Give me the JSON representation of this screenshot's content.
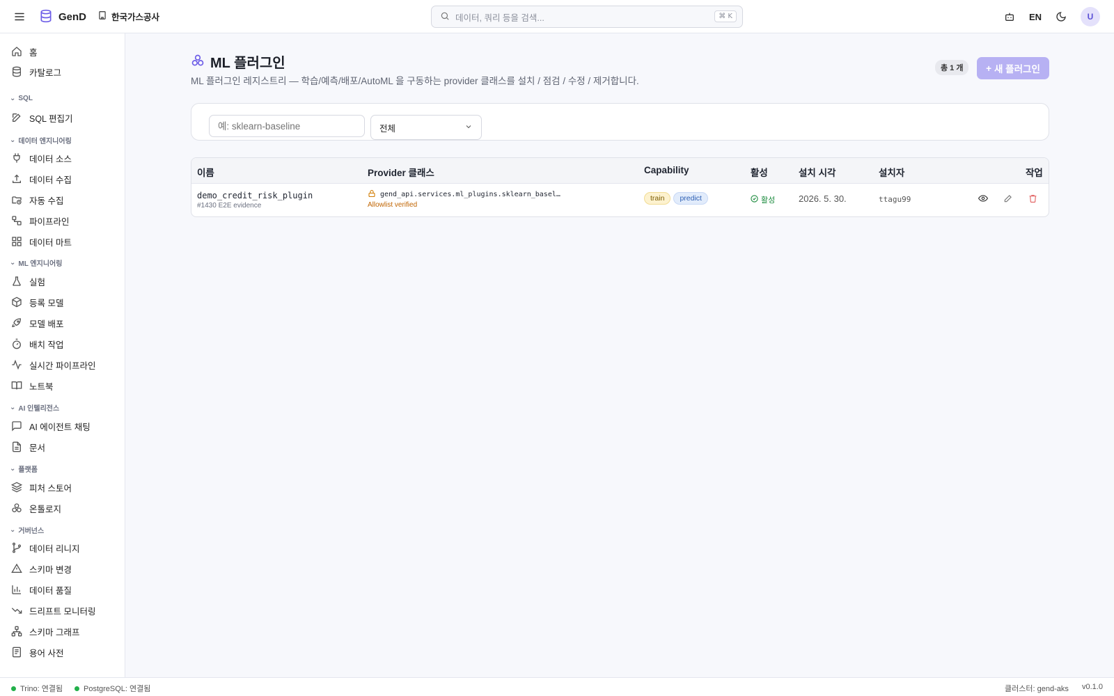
{
  "app": {
    "name": "GenD",
    "org": "한국가스공사"
  },
  "search": {
    "placeholder": "데이터, 쿼리 등을 검색...",
    "shortcut": "⌘ K"
  },
  "topbar": {
    "lang": "EN",
    "avatar": "U"
  },
  "sidebar": {
    "items": [
      {
        "label": "홈",
        "icon": "home-icon"
      },
      {
        "label": "카탈로그",
        "icon": "database-icon"
      }
    ],
    "sections": [
      {
        "title": "SQL",
        "items": [
          {
            "label": "SQL 편집기",
            "icon": "edit-icon"
          }
        ]
      },
      {
        "title": "데이터 엔지니어링",
        "items": [
          {
            "label": "데이터 소스",
            "icon": "plug-icon"
          },
          {
            "label": "데이터 수집",
            "icon": "upload-icon"
          },
          {
            "label": "자동 수집",
            "icon": "folder-clock-icon"
          },
          {
            "label": "파이프라인",
            "icon": "workflow-icon"
          },
          {
            "label": "데이터 마트",
            "icon": "grid-icon"
          }
        ]
      },
      {
        "title": "ML 엔지니어링",
        "items": [
          {
            "label": "실험",
            "icon": "flask-icon"
          },
          {
            "label": "등록 모델",
            "icon": "box-icon"
          },
          {
            "label": "모델 배포",
            "icon": "rocket-icon"
          },
          {
            "label": "배치 작업",
            "icon": "timer-icon"
          },
          {
            "label": "실시간 파이프라인",
            "icon": "activity-icon"
          },
          {
            "label": "노트북",
            "icon": "book-icon"
          }
        ]
      },
      {
        "title": "AI 인텔리전스",
        "items": [
          {
            "label": "AI 에이전트 채팅",
            "icon": "chat-icon"
          },
          {
            "label": "문서",
            "icon": "file-icon"
          }
        ]
      },
      {
        "title": "플랫폼",
        "items": [
          {
            "label": "피처 스토어",
            "icon": "layers-icon"
          },
          {
            "label": "온톨로지",
            "icon": "ontology-icon"
          }
        ]
      },
      {
        "title": "거버넌스",
        "items": [
          {
            "label": "데이터 리니지",
            "icon": "git-branch-icon"
          },
          {
            "label": "스키마 변경",
            "icon": "warning-icon"
          },
          {
            "label": "데이터 품질",
            "icon": "bar-chart-icon"
          },
          {
            "label": "드리프트 모니터링",
            "icon": "trending-down-icon"
          },
          {
            "label": "스키마 그래프",
            "icon": "network-icon"
          },
          {
            "label": "용어 사전",
            "icon": "dictionary-icon"
          }
        ]
      }
    ]
  },
  "page": {
    "title": "ML 플러그인",
    "description": "ML 플러그인 레지스트리 — 학습/예측/배포/AutoML 을 구동하는 provider 클래스를 설치 / 점검 / 수정 / 제거합니다.",
    "count_badge": "총 1 개",
    "new_button": "새 플러그인"
  },
  "filters": {
    "name_placeholder": "예: sklearn-baseline",
    "type_value": "전체"
  },
  "table": {
    "headers": [
      "이름",
      "Provider 클래스",
      "Capability",
      "활성",
      "설치 시각",
      "설치자",
      "작업"
    ],
    "rows": [
      {
        "name": "demo_credit_risk_plugin",
        "sub": "#1430 E2E evidence",
        "provider": "gend_api.services.ml_plugins.sklearn_basel…",
        "provider_note": "Allowlist verified",
        "capabilities": [
          "train",
          "predict"
        ],
        "status": "활성",
        "installed_at": "2026. 5. 30.",
        "installer": "ttagu99"
      }
    ]
  },
  "statusbar": {
    "trino": "Trino: 연결됨",
    "postgres": "PostgreSQL: 연결됨",
    "cluster": "클러스터: gend-aks",
    "version": "v0.1.0"
  },
  "colors": {
    "accent": "#6c5ce7",
    "primary_button": "#b7b1f3",
    "success": "#22b04a",
    "danger": "#e05a5a",
    "warning": "#d07a00"
  }
}
